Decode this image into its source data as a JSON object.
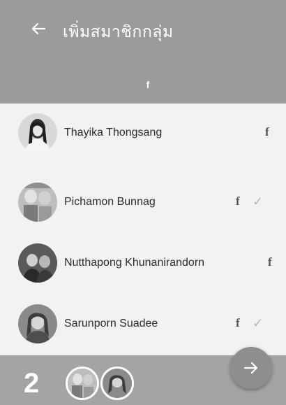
{
  "header": {
    "title": "เพิ่มสมาชิกกลุ่ม",
    "back_icon": "arrow-left-icon",
    "tab_icon": "facebook-icon",
    "tab_label": "f"
  },
  "members": [
    {
      "name": "Thayika Thongsang",
      "source_label": "f",
      "source_icon": "facebook-icon",
      "selected": false
    },
    {
      "name": "Pichamon Bunnag",
      "source_label": "f",
      "source_icon": "facebook-icon",
      "selected": true,
      "check": "✓"
    },
    {
      "name": "Nutthapong Khunanirandorn",
      "source_label": "f",
      "source_icon": "facebook-icon",
      "selected": false
    },
    {
      "name": "Sarunporn Suadee",
      "source_label": "f",
      "source_icon": "facebook-icon",
      "selected": true,
      "check": "✓"
    }
  ],
  "selection": {
    "count": "2",
    "next_icon": "arrow-right-icon"
  },
  "colors": {
    "header": "#9b9b9b",
    "background": "#f2f2f2",
    "bottom_bar": "#a4a4a4",
    "fab": "#8e8e8e"
  }
}
